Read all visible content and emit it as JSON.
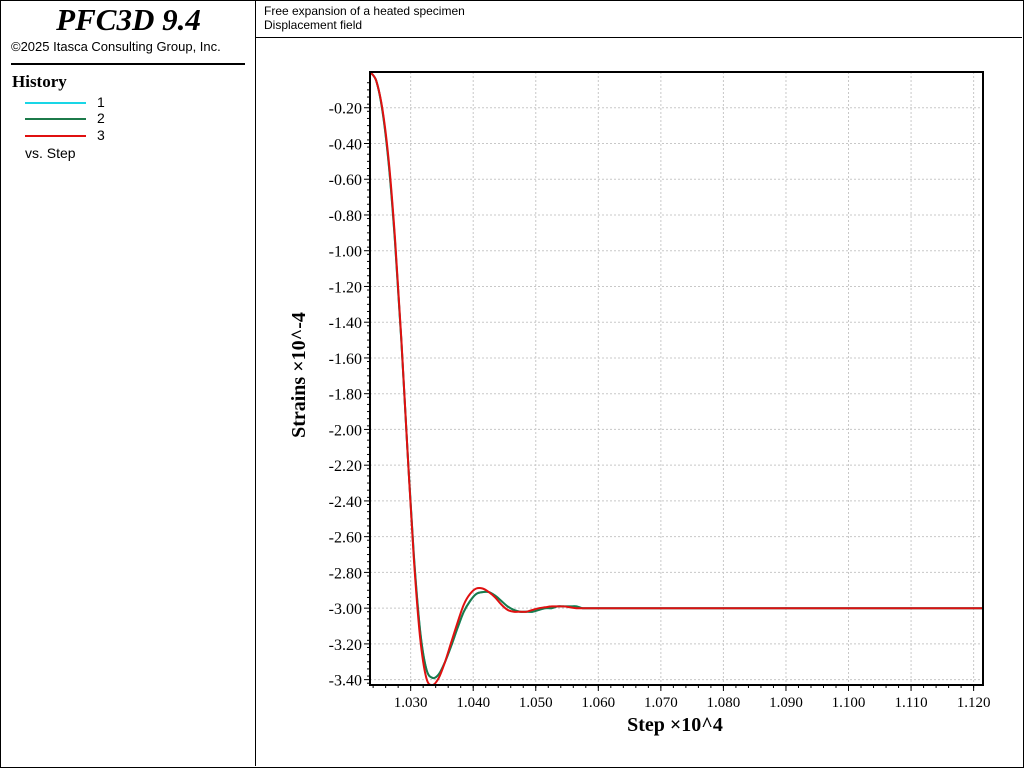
{
  "app": {
    "title": "PFC3D 9.4",
    "copyright": "©2025 Itasca Consulting Group, Inc."
  },
  "header": {
    "line1": "Free expansion of a heated specimen",
    "line2": "Displacement field"
  },
  "legend": {
    "title": "History",
    "items": [
      {
        "label": "1",
        "color": "#19d6e6"
      },
      {
        "label": "2",
        "color": "#1c7a4a"
      },
      {
        "label": "3",
        "color": "#e01010"
      }
    ],
    "vs": "vs. Step"
  },
  "chart_data": {
    "type": "line",
    "xlabel": "Step ×10^4",
    "ylabel": "Strains ×10^-4",
    "xlim": [
      1.0235,
      1.1215
    ],
    "ylim": [
      -3.43,
      0.0
    ],
    "xticks": [
      "1.030",
      "1.040",
      "1.050",
      "1.060",
      "1.070",
      "1.080",
      "1.090",
      "1.100",
      "1.110",
      "1.120"
    ],
    "yticks": [
      "-0.20",
      "-0.40",
      "-0.60",
      "-0.80",
      "-1.00",
      "-1.20",
      "-1.40",
      "-1.60",
      "-1.80",
      "-2.00",
      "-2.20",
      "-2.40",
      "-2.60",
      "-2.80",
      "-3.00",
      "-3.20",
      "-3.40"
    ],
    "grid": true,
    "x": [
      1.0235,
      1.0245,
      1.0255,
      1.0265,
      1.0275,
      1.0285,
      1.0295,
      1.0305,
      1.0315,
      1.0325,
      1.0335,
      1.0345,
      1.0355,
      1.0365,
      1.0375,
      1.0385,
      1.0395,
      1.0405,
      1.0415,
      1.0425,
      1.0435,
      1.0445,
      1.0455,
      1.0465,
      1.0475,
      1.0485,
      1.0495,
      1.0505,
      1.0515,
      1.0525,
      1.0535,
      1.0545,
      1.0555,
      1.0565,
      1.0575,
      1.0585,
      1.0595,
      1.0605,
      1.0615,
      1.0625,
      1.0635,
      1.0645,
      1.0655,
      1.0665,
      1.0675,
      1.0685,
      1.0695,
      1.0705,
      1.0715,
      1.0725,
      1.0735,
      1.0745,
      1.0755,
      1.0765,
      1.0775,
      1.0785,
      1.0795,
      1.0825,
      1.0875,
      1.0925,
      1.0975,
      1.1025,
      1.1075,
      1.1125,
      1.1175,
      1.1215
    ],
    "series": [
      {
        "name": "1",
        "color": "#19d6e6",
        "values": [
          0.0,
          -0.05,
          -0.22,
          -0.52,
          -0.95,
          -1.5,
          -2.12,
          -2.7,
          -3.12,
          -3.34,
          -3.39,
          -3.37,
          -3.3,
          -3.21,
          -3.11,
          -3.02,
          -2.96,
          -2.92,
          -2.91,
          -2.91,
          -2.93,
          -2.96,
          -2.99,
          -3.01,
          -3.02,
          -3.02,
          -3.02,
          -3.01,
          -3.0,
          -3.0,
          -2.99,
          -2.99,
          -2.99,
          -2.99,
          -3.0,
          -3.0,
          -3.0,
          -3.0,
          -3.0,
          -3.0,
          -3.0,
          -3.0,
          -3.0,
          -3.0,
          -3.0,
          -3.0,
          -3.0,
          -3.0,
          -3.0,
          -3.0,
          -3.0,
          -3.0,
          -3.0,
          -3.0,
          -3.0,
          -3.0,
          -3.0,
          -3.0,
          -3.0,
          -3.0,
          -3.0,
          -3.0,
          -3.0,
          -3.0,
          -3.0,
          -3.0
        ]
      },
      {
        "name": "2",
        "color": "#1c7a4a",
        "values": [
          0.0,
          -0.05,
          -0.22,
          -0.52,
          -0.95,
          -1.5,
          -2.12,
          -2.7,
          -3.12,
          -3.34,
          -3.39,
          -3.37,
          -3.3,
          -3.21,
          -3.11,
          -3.02,
          -2.96,
          -2.92,
          -2.91,
          -2.91,
          -2.93,
          -2.96,
          -2.99,
          -3.01,
          -3.02,
          -3.02,
          -3.02,
          -3.01,
          -3.0,
          -3.0,
          -2.99,
          -2.99,
          -2.99,
          -2.99,
          -3.0,
          -3.0,
          -3.0,
          -3.0,
          -3.0,
          -3.0,
          -3.0,
          -3.0,
          -3.0,
          -3.0,
          -3.0,
          -3.0,
          -3.0,
          -3.0,
          -3.0,
          -3.0,
          -3.0,
          -3.0,
          -3.0,
          -3.0,
          -3.0,
          -3.0,
          -3.0,
          -3.0,
          -3.0,
          -3.0,
          -3.0,
          -3.0,
          -3.0,
          -3.0,
          -3.0,
          -3.0
        ]
      },
      {
        "name": "3",
        "color": "#e01010",
        "values": [
          0.0,
          -0.05,
          -0.21,
          -0.5,
          -0.93,
          -1.49,
          -2.12,
          -2.72,
          -3.16,
          -3.39,
          -3.43,
          -3.39,
          -3.3,
          -3.19,
          -3.08,
          -2.98,
          -2.92,
          -2.89,
          -2.89,
          -2.91,
          -2.94,
          -2.98,
          -3.01,
          -3.02,
          -3.02,
          -3.02,
          -3.01,
          -3.0,
          -2.995,
          -2.99,
          -2.99,
          -2.99,
          -2.995,
          -3.0,
          -3.0,
          -3.0,
          -3.0,
          -3.0,
          -3.0,
          -3.0,
          -3.0,
          -3.0,
          -3.0,
          -3.0,
          -3.0,
          -3.0,
          -3.0,
          -3.0,
          -3.0,
          -3.0,
          -3.0,
          -3.0,
          -3.0,
          -3.0,
          -3.0,
          -3.0,
          -3.0,
          -3.0,
          -3.0,
          -3.0,
          -3.0,
          -3.0,
          -3.0,
          -3.0,
          -3.0,
          -3.0
        ]
      }
    ]
  }
}
